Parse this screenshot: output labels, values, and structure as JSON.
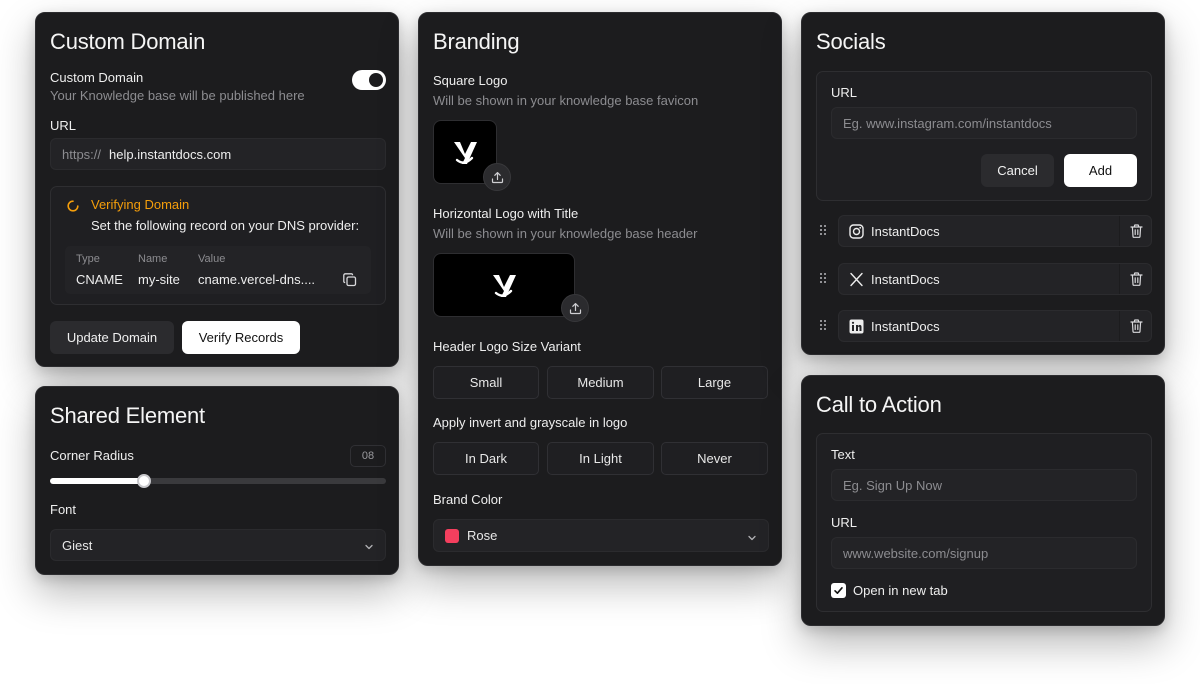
{
  "custom_domain": {
    "title": "Custom Domain",
    "toggle_label": "Custom Domain",
    "toggle_desc": "Your Knowledge base will be published here",
    "toggle_on": true,
    "url_label": "URL",
    "url_prefix": "https://",
    "url_value": "help.instantdocs.com",
    "verify_title": "Verifying Domain",
    "verify_desc": "Set the following record on your DNS provider:",
    "record_headers": {
      "type": "Type",
      "name": "Name",
      "value": "Value"
    },
    "record": {
      "type": "CNAME",
      "name": "my-site",
      "value": "cname.vercel-dns...."
    },
    "update_button": "Update Domain",
    "verify_button": "Verify Records"
  },
  "shared_element": {
    "title": "Shared Element",
    "radius_label": "Corner Radius",
    "radius_value": "08",
    "radius_fraction": 0.28,
    "font_label": "Font",
    "font_value": "Giest"
  },
  "branding": {
    "title": "Branding",
    "square_logo_label": "Square Logo",
    "square_logo_desc": "Will be shown in your knowledge base favicon",
    "horizontal_logo_label": "Horizontal Logo with Title",
    "horizontal_logo_desc": "Will be shown in your knowledge base header",
    "size_variant_label": "Header Logo Size Variant",
    "size_options": [
      "Small",
      "Medium",
      "Large"
    ],
    "invert_label": "Apply invert and grayscale in logo",
    "invert_options": [
      "In Dark",
      "In Light",
      "Never"
    ],
    "brand_color_label": "Brand Color",
    "brand_color_value": "Rose",
    "brand_color_hex": "#f43f5e"
  },
  "socials": {
    "title": "Socials",
    "url_label": "URL",
    "url_placeholder": "Eg. www.instagram.com/instantdocs",
    "cancel_button": "Cancel",
    "add_button": "Add",
    "items": [
      {
        "icon": "instagram-icon",
        "label": "InstantDocs"
      },
      {
        "icon": "x-icon",
        "label": "InstantDocs"
      },
      {
        "icon": "linkedin-icon",
        "label": "InstantDocs"
      }
    ]
  },
  "cta": {
    "title": "Call to Action",
    "text_label": "Text",
    "text_placeholder": "Eg. Sign Up Now",
    "url_label": "URL",
    "url_placeholder": "www.website.com/signup",
    "new_tab_label": "Open in new tab",
    "new_tab_checked": true
  },
  "colors": {
    "accent_orange": "#f59e0b",
    "card_bg": "#1c1c1e"
  }
}
